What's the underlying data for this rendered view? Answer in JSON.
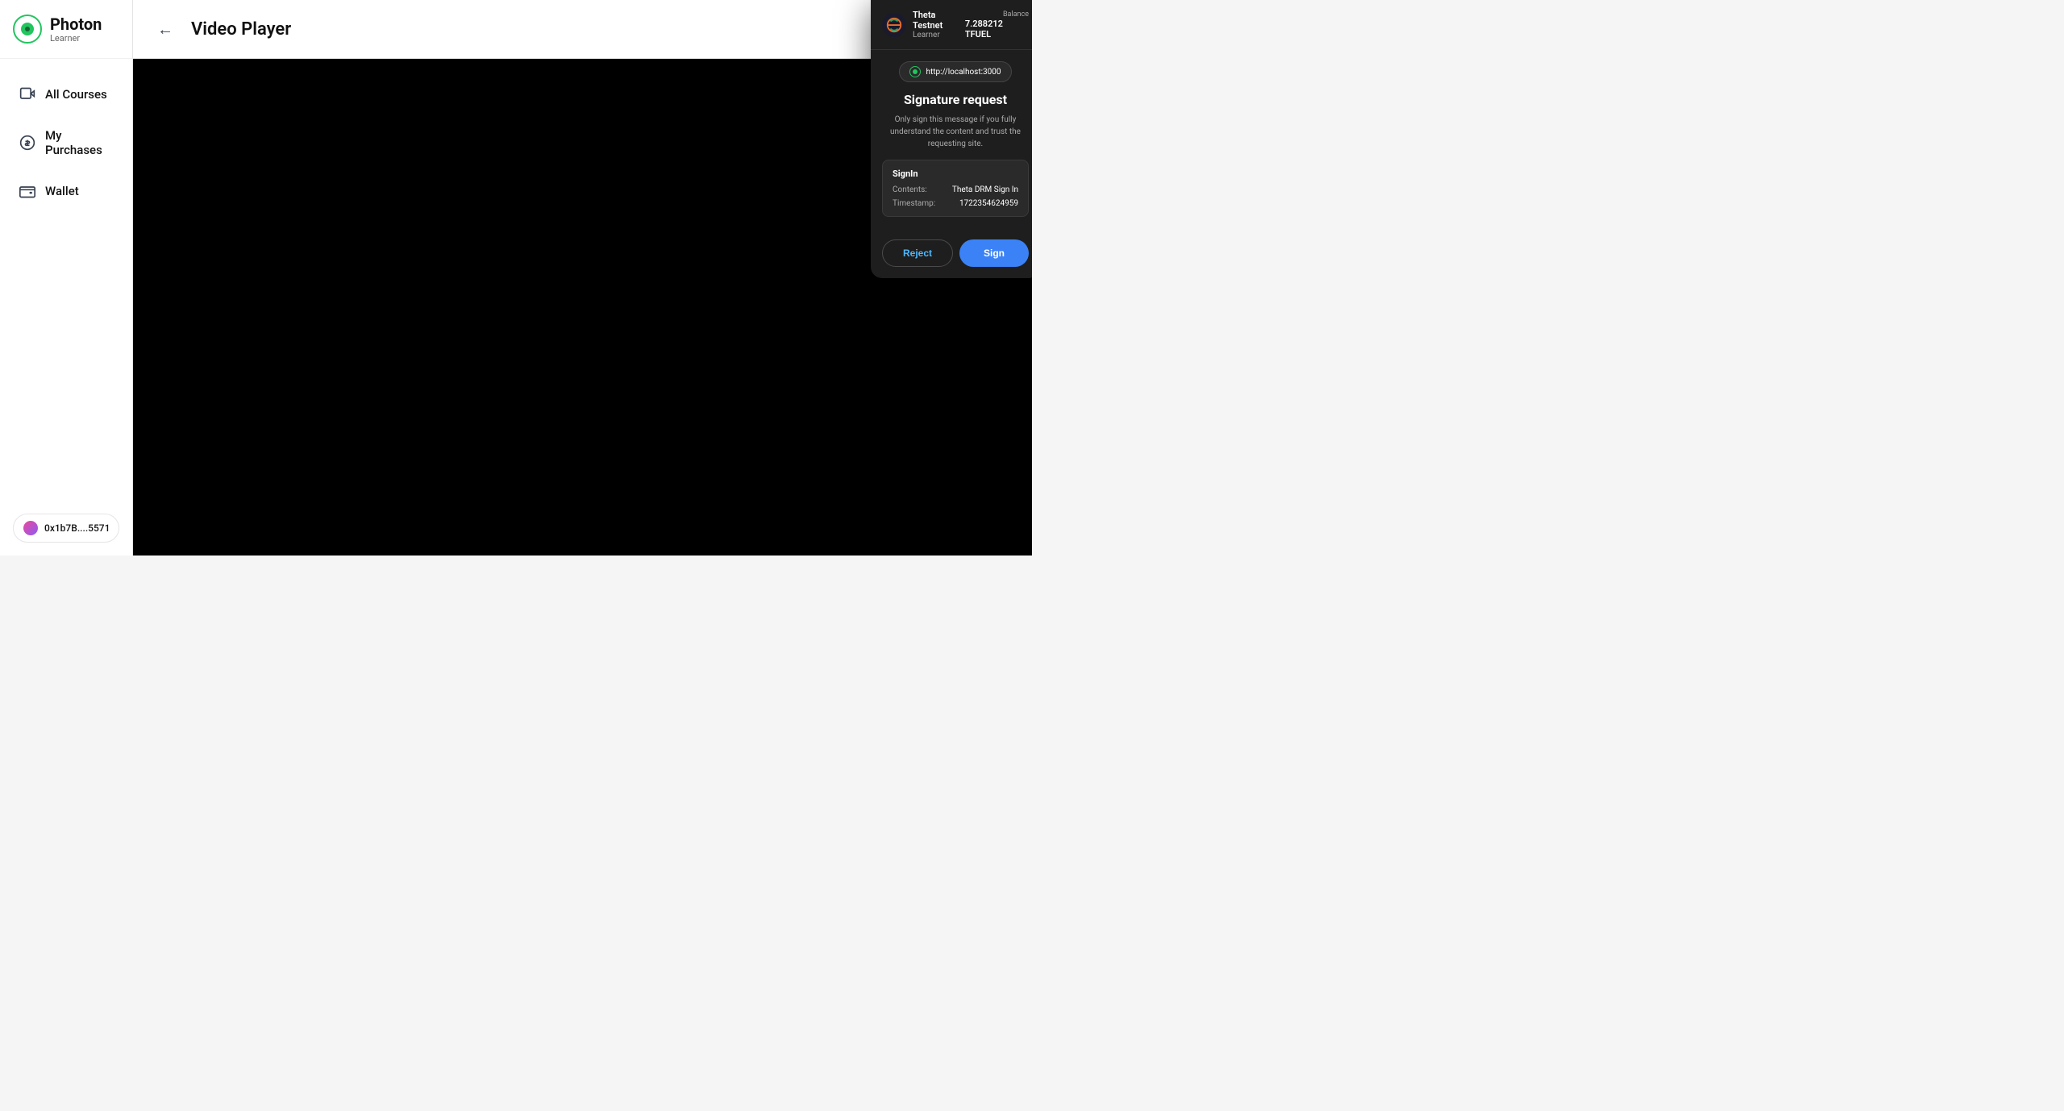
{
  "app": {
    "name": "Photon",
    "role": "Learner"
  },
  "sidebar": {
    "nav_items": [
      {
        "id": "all-courses",
        "label": "All Courses",
        "icon": "video-icon"
      },
      {
        "id": "my-purchases",
        "label": "My Purchases",
        "icon": "dollar-icon"
      },
      {
        "id": "wallet",
        "label": "Wallet",
        "icon": "wallet-icon"
      }
    ],
    "wallet_address": "0x1b7B....5571"
  },
  "main": {
    "back_button": "←",
    "page_title": "Video Player"
  },
  "popup": {
    "network_name": "Theta Testnet",
    "account": "Learner",
    "balance_label": "Balance",
    "balance_amount": "7.288212 TFUEL",
    "site_url": "http://localhost:3000",
    "sig_title": "Signature request",
    "sig_desc": "Only sign this message if you fully understand the content and trust the requesting site.",
    "card": {
      "title": "SignIn",
      "contents_label": "Contents:",
      "contents_value": "Theta DRM Sign In",
      "timestamp_label": "Timestamp:",
      "timestamp_value": "1722354624959"
    },
    "reject_label": "Reject",
    "sign_label": "Sign"
  }
}
